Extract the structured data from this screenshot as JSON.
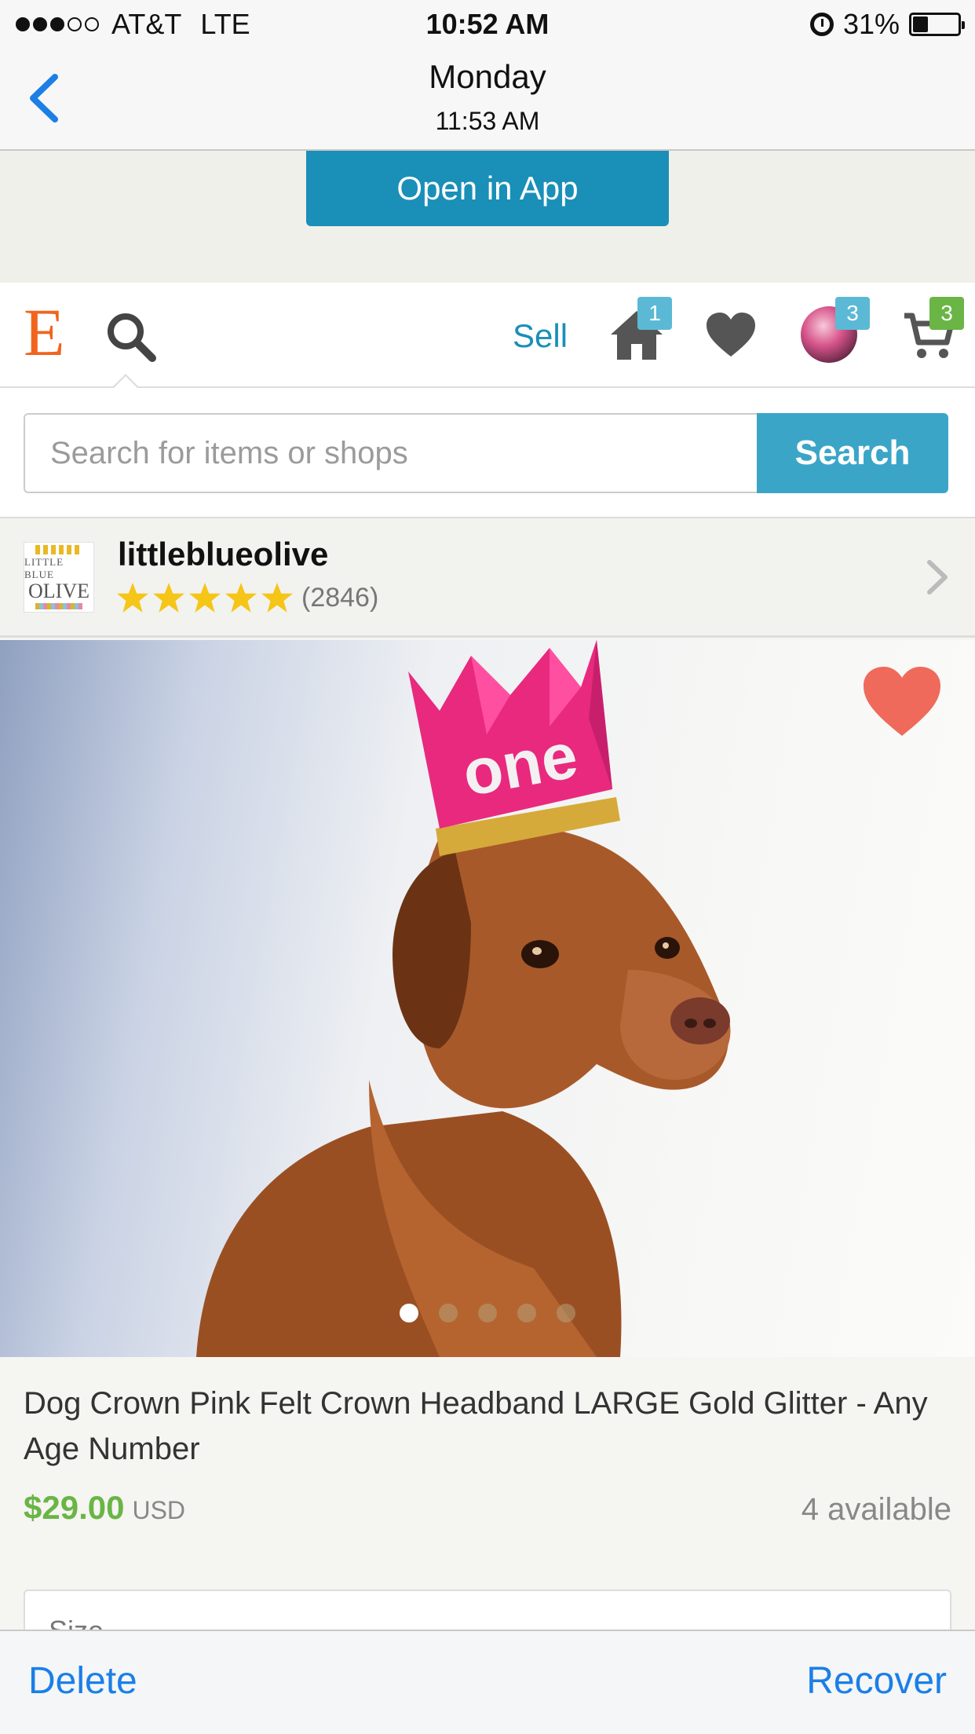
{
  "status_bar": {
    "carrier": "AT&T",
    "network": "LTE",
    "time": "10:52 AM",
    "battery": "31%",
    "battery_level": 0.31
  },
  "nav": {
    "title": "Monday",
    "subtitle": "11:53 AM"
  },
  "open_in_app": {
    "label": "Open in App"
  },
  "header": {
    "logo": "E",
    "sell_label": "Sell",
    "home_badge": "1",
    "avatar_badge": "3",
    "cart_badge": "3"
  },
  "search": {
    "placeholder": "Search for items or shops",
    "button_label": "Search"
  },
  "shop": {
    "logo_line1": "LITTLE BLUE",
    "logo_line2": "OLIVE",
    "name": "littleblueolive",
    "rating": 5,
    "reviews": "(2846)"
  },
  "product": {
    "image_pages": 5,
    "current_page": 1,
    "title": "Dog Crown Pink Felt Crown Headband LARGE Gold Glitter - Any Age Number",
    "price": "$29.00",
    "currency": "USD",
    "availability": "4 available",
    "crown_text": "one",
    "size_label": "Size"
  },
  "toolbar": {
    "delete_label": "Delete",
    "recover_label": "Recover"
  },
  "colors": {
    "etsy_orange": "#f1641e",
    "accent_blue": "#1a8fb8",
    "price_green": "#6ab546",
    "ios_blue": "#1b7fe6",
    "favorite_red": "#ef6a5a",
    "crown_pink": "#e8297e"
  }
}
